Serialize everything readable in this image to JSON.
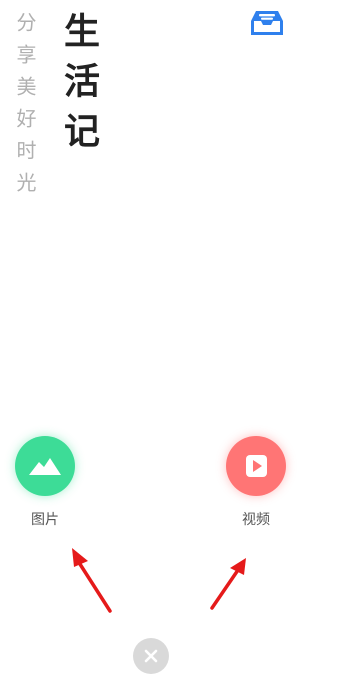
{
  "header": {
    "subtitle": "分享美好时光",
    "title": "生活记",
    "inbox_icon": "inbox-tray-icon",
    "inbox_color": "#2f80ed"
  },
  "actions": [
    {
      "label": "图片",
      "icon": "mountain-image-icon",
      "color": "#3ddc97"
    },
    {
      "label": "视频",
      "icon": "play-icon",
      "color": "#ff7575"
    }
  ],
  "annotations": {
    "arrow_color": "#e51a1a"
  },
  "close": {
    "icon": "close-icon",
    "color": "#d9d9d9"
  }
}
